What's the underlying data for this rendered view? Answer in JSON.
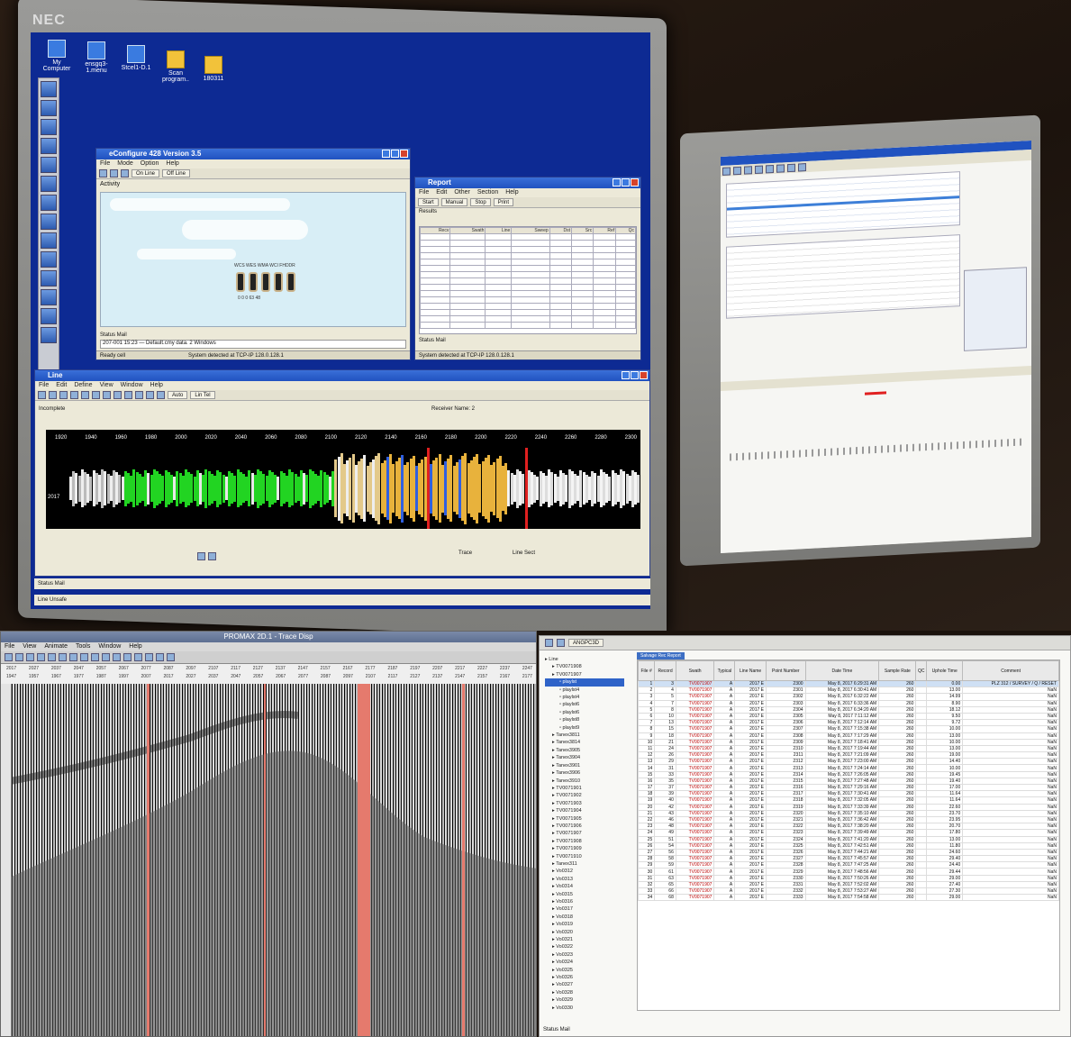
{
  "monitor_left": {
    "brand": "NEC",
    "desktop_icons": [
      {
        "label": "My Computer",
        "icon": "computer-icon"
      },
      {
        "label": "ensgq3-1.menu",
        "icon": "network-icon"
      },
      {
        "label": "Stcel1-D.1",
        "icon": "shortcut-icon"
      },
      {
        "label": "Scan program..",
        "icon": "folder-icon"
      },
      {
        "label": "180311",
        "icon": "folder-icon"
      }
    ],
    "activity_window": {
      "title": "eConfigure 428 Version 3.5",
      "menu": [
        "File",
        "Mode",
        "Option",
        "Help"
      ],
      "buttons": [
        "On Line",
        "Off Line"
      ],
      "section_label": "Activity",
      "unit_label": "WCS  WES  WMA  WCI  FHDDR",
      "unit_numbers": "0    0    0    63    48",
      "status_label": "Status Mail",
      "status_text": "207-001 15:23 — Default.cmy data. 2 Windows",
      "bottom_left": "Ready cell",
      "bottom_right": "System detected at TCP-IP 128.0.128.1"
    },
    "report_window": {
      "title": "Report",
      "menu": [
        "File",
        "Edit",
        "Other",
        "Section",
        "Help"
      ],
      "buttons": [
        "Start",
        "Manual",
        "Stop",
        "Print"
      ],
      "section_label": "Results",
      "columns": [
        "Recv",
        "Swath",
        "Line",
        "Sweep",
        "Dst",
        "Src",
        "Ref",
        "Qc"
      ],
      "status_label": "Status Mail",
      "bottom_right": "System detected at TCP-IP 128.0.128.1"
    },
    "seismic_window": {
      "title": "Line",
      "menu": [
        "File",
        "Edit",
        "Define",
        "View",
        "Window",
        "Help"
      ],
      "toolbar_buttons": [
        "Auto",
        "Lin Tel"
      ],
      "field_label": "Receiver Name: 2",
      "cursor_label": "Incomplete",
      "stations": [
        "1920",
        "1940",
        "1960",
        "1980",
        "2000",
        "2020",
        "2040",
        "2060",
        "2080",
        "2100",
        "2120",
        "2140",
        "2160",
        "2180",
        "2200",
        "2220",
        "2240",
        "2260",
        "2280",
        "2300"
      ],
      "row_label": "2017",
      "bottom_fields": [
        "Trace",
        "Line Sect"
      ],
      "status_label": "Status Mail",
      "bottom_status": "Line Unsafe"
    }
  },
  "seismic_viewer": {
    "title": "PROMAX 2D.1 - Trace Disp",
    "menu": [
      "File",
      "View",
      "Animate",
      "Tools",
      "Window",
      "Help"
    ],
    "axis_row1": [
      "2017",
      "2027",
      "2037",
      "2047",
      "2057",
      "2067",
      "2077",
      "2087",
      "2097",
      "2107",
      "2117",
      "2127",
      "2137",
      "2147",
      "2157",
      "2167",
      "2177",
      "2187",
      "2197",
      "2207",
      "2217",
      "2227",
      "2237",
      "2247"
    ],
    "axis_row2": [
      "1947",
      "1957",
      "1967",
      "1977",
      "1987",
      "1997",
      "2007",
      "2017",
      "2027",
      "2037",
      "2047",
      "2057",
      "2067",
      "2077",
      "2087",
      "2097",
      "2107",
      "2117",
      "2127",
      "2137",
      "2147",
      "2157",
      "2167",
      "2177"
    ]
  },
  "data_table": {
    "toolbar_value": "ANGPC3D",
    "tab": "Salvage Rec Report",
    "tree": [
      "Line",
      "TV0071908",
      "TV0071907",
      "playlst",
      "playlst4",
      "playlst4",
      "playlst6",
      "playlst6",
      "playlst8",
      "playlst9",
      "Tanex3811",
      "Tanex3814",
      "Tanex3905",
      "Tanex3904",
      "Tanex3901",
      "Tanex3906",
      "Tanex3910",
      "TV0071901",
      "TV0071902",
      "TV0071903",
      "TV0071904",
      "TV0071905",
      "TV0071906",
      "TV0071907",
      "TV0071908",
      "TV0071909",
      "TV0071910",
      "Tanex311",
      "Vo0312",
      "Vo0313",
      "Vo0314",
      "Vo0315",
      "Vo0316",
      "Vo0317",
      "Vo0318",
      "Vo0319",
      "Vo0320",
      "Vo0321",
      "Vo0322",
      "Vo0323",
      "Vo0324",
      "Vo0325",
      "Vo0326",
      "Vo0327",
      "Vo0328",
      "Vo0329",
      "Vo0330"
    ],
    "selected_tree_index": 3,
    "columns": [
      "File #",
      "Record",
      "Swath",
      "Typical",
      "Line Name",
      "Point Number",
      "Date Time",
      "Sample Rate",
      "QC",
      "Uphole Time",
      "Comment"
    ],
    "rows": [
      [
        "1",
        "3",
        "TV0071907",
        "A",
        "2017 E",
        "2300",
        "May 8, 2017 6:29:31 AM",
        "260",
        "",
        "0.00",
        "PLZ 312 / SURVEY / Q / RESET"
      ],
      [
        "2",
        "4",
        "TV0071907",
        "A",
        "2017 E",
        "2301",
        "May 8, 2017 6:30:41 AM",
        "260",
        "",
        "13.00",
        "NaN"
      ],
      [
        "3",
        "5",
        "TV0071907",
        "A",
        "2017 E",
        "2302",
        "May 8, 2017 6:32:22 AM",
        "260",
        "",
        "14.99",
        "NaN"
      ],
      [
        "4",
        "7",
        "TV0071907",
        "A",
        "2017 E",
        "2303",
        "May 8, 2017 6:33:36 AM",
        "260",
        "",
        "8.90",
        "NaN"
      ],
      [
        "5",
        "8",
        "TV0071907",
        "A",
        "2017 E",
        "2304",
        "May 8, 2017 6:34:20 AM",
        "260",
        "",
        "18.12",
        "NaN"
      ],
      [
        "6",
        "10",
        "TV0071907",
        "A",
        "2017 E",
        "2305",
        "May 8, 2017 7:11:12 AM",
        "260",
        "",
        "9.50",
        "NaN"
      ],
      [
        "7",
        "13",
        "TV0071907",
        "A",
        "2017 E",
        "2306",
        "May 8, 2017 7:12:14 AM",
        "260",
        "",
        "9.72",
        "NaN"
      ],
      [
        "8",
        "15",
        "TV0071907",
        "A",
        "2017 E",
        "2307",
        "May 8, 2017 7:15:38 AM",
        "260",
        "",
        "10.00",
        "NaN"
      ],
      [
        "9",
        "18",
        "TV0071907",
        "A",
        "2017 E",
        "2308",
        "May 8, 2017 7:17:29 AM",
        "260",
        "",
        "13.00",
        "NaN"
      ],
      [
        "10",
        "21",
        "TV0071907",
        "A",
        "2017 E",
        "2309",
        "May 8, 2017 7:18:41 AM",
        "260",
        "",
        "10.00",
        "NaN"
      ],
      [
        "11",
        "24",
        "TV0071907",
        "A",
        "2017 E",
        "2310",
        "May 8, 2017 7:19:44 AM",
        "260",
        "",
        "13.00",
        "NaN"
      ],
      [
        "12",
        "26",
        "TV0071907",
        "A",
        "2017 E",
        "2311",
        "May 8, 2017 7:21:09 AM",
        "260",
        "",
        "19.00",
        "NaN"
      ],
      [
        "13",
        "29",
        "TV0071907",
        "A",
        "2017 E",
        "2312",
        "May 8, 2017 7:23:00 AM",
        "260",
        "",
        "14.40",
        "NaN"
      ],
      [
        "14",
        "31",
        "TV0071907",
        "A",
        "2017 E",
        "2313",
        "May 8, 2017 7:24:14 AM",
        "260",
        "",
        "10.00",
        "NaN"
      ],
      [
        "15",
        "33",
        "TV0071907",
        "A",
        "2017 E",
        "2314",
        "May 8, 2017 7:26:05 AM",
        "260",
        "",
        "19.45",
        "NaN"
      ],
      [
        "16",
        "35",
        "TV0071907",
        "A",
        "2017 E",
        "2315",
        "May 8, 2017 7:27:48 AM",
        "260",
        "",
        "19.40",
        "NaN"
      ],
      [
        "17",
        "37",
        "TV0071907",
        "A",
        "2017 E",
        "2316",
        "May 8, 2017 7:29:16 AM",
        "260",
        "",
        "17.00",
        "NaN"
      ],
      [
        "18",
        "39",
        "TV0071907",
        "A",
        "2017 E",
        "2317",
        "May 8, 2017 7:30:41 AM",
        "260",
        "",
        "11.64",
        "NaN"
      ],
      [
        "19",
        "40",
        "TV0071907",
        "A",
        "2017 E",
        "2318",
        "May 8, 2017 7:32:05 AM",
        "260",
        "",
        "11.64",
        "NaN"
      ],
      [
        "20",
        "42",
        "TV0071907",
        "A",
        "2017 E",
        "2319",
        "May 8, 2017 7:33:39 AM",
        "260",
        "",
        "22.60",
        "NaN"
      ],
      [
        "21",
        "43",
        "TV0071907",
        "A",
        "2017 E",
        "2320",
        "May 8, 2017 7:35:10 AM",
        "260",
        "",
        "23.70",
        "NaN"
      ],
      [
        "22",
        "46",
        "TV0071907",
        "A",
        "2017 E",
        "2321",
        "May 8, 2017 7:36:42 AM",
        "260",
        "",
        "23.95",
        "NaN"
      ],
      [
        "23",
        "48",
        "TV0071907",
        "A",
        "2017 E",
        "2322",
        "May 8, 2017 7:38:20 AM",
        "260",
        "",
        "20.70",
        "NaN"
      ],
      [
        "24",
        "49",
        "TV0071907",
        "A",
        "2017 E",
        "2323",
        "May 8, 2017 7:39:49 AM",
        "260",
        "",
        "17.80",
        "NaN"
      ],
      [
        "25",
        "51",
        "TV0071907",
        "A",
        "2017 E",
        "2324",
        "May 8, 2017 7:41:20 AM",
        "260",
        "",
        "13.00",
        "NaN"
      ],
      [
        "26",
        "54",
        "TV0071907",
        "A",
        "2017 E",
        "2325",
        "May 8, 2017 7:42:51 AM",
        "260",
        "",
        "11.80",
        "NaN"
      ],
      [
        "27",
        "56",
        "TV0071907",
        "A",
        "2017 E",
        "2326",
        "May 8, 2017 7:44:21 AM",
        "260",
        "",
        "24.60",
        "NaN"
      ],
      [
        "28",
        "58",
        "TV0071907",
        "A",
        "2017 E",
        "2327",
        "May 8, 2017 7:45:57 AM",
        "260",
        "",
        "29.40",
        "NaN"
      ],
      [
        "29",
        "59",
        "TV0071907",
        "A",
        "2017 E",
        "2328",
        "May 8, 2017 7:47:25 AM",
        "260",
        "",
        "24.40",
        "NaN"
      ],
      [
        "30",
        "61",
        "TV0071907",
        "A",
        "2017 E",
        "2329",
        "May 8, 2017 7:48:56 AM",
        "260",
        "",
        "29.44",
        "NaN"
      ],
      [
        "31",
        "63",
        "TV0071907",
        "A",
        "2017 E",
        "2330",
        "May 8, 2017 7:50:26 AM",
        "260",
        "",
        "29.00",
        "NaN"
      ],
      [
        "32",
        "65",
        "TV0071907",
        "A",
        "2017 E",
        "2331",
        "May 8, 2017 7:52:02 AM",
        "260",
        "",
        "27.40",
        "NaN"
      ],
      [
        "33",
        "66",
        "TV0071907",
        "A",
        "2017 E",
        "2332",
        "May 8, 2017 7:53:27 AM",
        "260",
        "",
        "27.30",
        "NaN"
      ],
      [
        "34",
        "68",
        "TV0071907",
        "A",
        "2017 E",
        "2333",
        "May 8, 2017 7:54:58 AM",
        "260",
        "",
        "29.00",
        "NaN"
      ]
    ],
    "status_label": "Status Mail"
  },
  "colors": {
    "desktop_bg": "#0d2a93",
    "titlebar": "#2052c0",
    "green_trace": "#22d422",
    "orange_trace": "#e8b23c",
    "red_marker": "#e02020"
  }
}
